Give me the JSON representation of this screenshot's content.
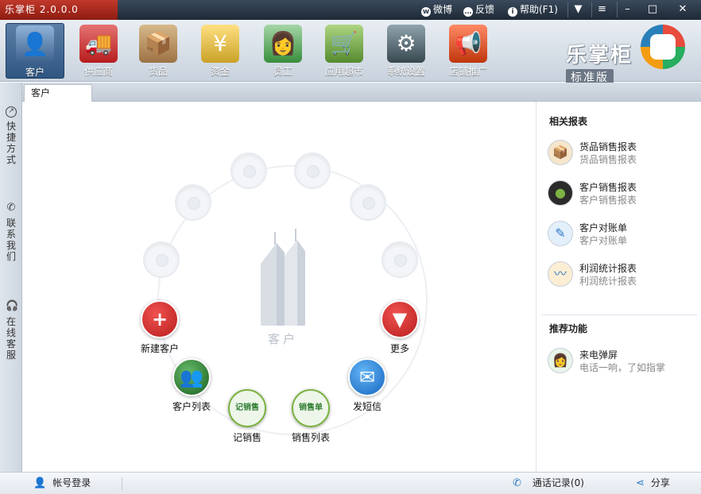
{
  "window": {
    "title": "乐掌柜 2.0.0.0",
    "weibo": "微博",
    "feedback": "反馈",
    "help": "帮助(F1)"
  },
  "toolbar": {
    "items": [
      {
        "label": "客户",
        "icon": "customer-icon"
      },
      {
        "label": "供应商",
        "icon": "truck-icon"
      },
      {
        "label": "货品",
        "icon": "boxes-icon"
      },
      {
        "label": "资金",
        "icon": "money-icon"
      },
      {
        "label": "员工",
        "icon": "employee-icon"
      },
      {
        "label": "应用超市",
        "icon": "cart-icon"
      },
      {
        "label": "系统设置",
        "icon": "settings-icon"
      },
      {
        "label": "店铺推广",
        "icon": "megaphone-icon"
      }
    ],
    "active_index": 0,
    "logo_line1": "乐掌柜",
    "logo_line2": "标准版"
  },
  "tabs": {
    "active": "客户"
  },
  "leftbar": {
    "shortcut": "快捷方式",
    "contact": "联系我们",
    "support": "在线客服"
  },
  "hub": {
    "center_label": "客户",
    "actions": {
      "new_customer": "新建客户",
      "more": "更多",
      "customer_list": "客户列表",
      "send_sms": "发短信",
      "record_sale": "记销售",
      "sales_list": "销售列表"
    },
    "icon_texts": {
      "record_sale": "记销售",
      "sales_list": "销售单"
    }
  },
  "reports": {
    "heading": "相关报表",
    "items": [
      {
        "title": "货品销售报表",
        "sub": "货品销售报表",
        "icon": "goods-report-icon"
      },
      {
        "title": "客户销售报表",
        "sub": "客户销售报表",
        "icon": "customer-report-icon"
      },
      {
        "title": "客户对账单",
        "sub": "客户对账单",
        "icon": "statement-icon"
      },
      {
        "title": "利润统计报表",
        "sub": "利润统计报表",
        "icon": "profit-chart-icon"
      }
    ]
  },
  "recommend": {
    "heading": "推荐功能",
    "items": [
      {
        "title": "来电弹屏",
        "sub": "电话一响，了如指掌",
        "icon": "operator-avatar-icon"
      }
    ]
  },
  "statusbar": {
    "login": "帐号登录",
    "call_log": "通话记录(0)",
    "share": "分享"
  },
  "colors": {
    "title_bg": "#1e2936",
    "accent_red": "#c0392b",
    "new_customer": "#c62828",
    "more": "#c62828",
    "customer_list": "#2e8b2e",
    "send_sms": "#2f79c4",
    "record_sale": "#43a047",
    "sales_list": "#43a047"
  }
}
